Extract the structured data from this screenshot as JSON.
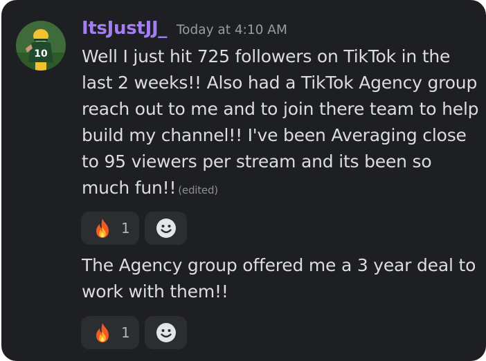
{
  "message_group": {
    "username": "ItsJustJJ_",
    "timestamp": "Today at 4:10 AM",
    "avatar_icon": "football-player-avatar",
    "messages": [
      {
        "text": "Well I just hit 725 followers on TikTok in the last 2 weeks!! Also had a TikTok Agency group reach out to me and to join there team to help build my channel!! I've been Averaging close to 95 viewers per stream and its been so much fun!!",
        "edited_label": "(edited)",
        "reactions": [
          {
            "emoji": "fire-icon",
            "count": "1"
          }
        ],
        "add_reaction_icon": "add-reaction-icon"
      },
      {
        "text": "The Agency group offered me a 3 year deal to work with them!!",
        "reactions": [
          {
            "emoji": "fire-icon",
            "count": "1"
          }
        ],
        "add_reaction_icon": "add-reaction-icon"
      }
    ]
  },
  "colors": {
    "background": "#1e1f22",
    "username": "#a37df2",
    "text": "#dcdde1",
    "muted": "#9a9ca3",
    "reaction_bg": "#2b2d31"
  }
}
